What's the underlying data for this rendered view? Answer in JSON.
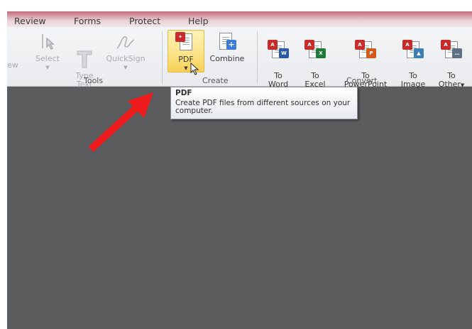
{
  "menu_tabs": [
    "Review",
    "Forms",
    "Protect",
    "Help"
  ],
  "ribbon": {
    "view_partial": "ew",
    "tools": {
      "select_label": "Select",
      "type_text_label": "Type\nText",
      "quicksign_label": "QuickSign",
      "group_label": "Tools"
    },
    "create": {
      "pdf_label": "PDF",
      "combine_label": "Combine",
      "group_label": "Create"
    },
    "convert": {
      "to_word_label": "To\nWord",
      "to_excel_label": "To\nExcel",
      "to_powerpoint_label": "To\nPowerPoint",
      "to_image_label": "To\nImage",
      "to_other_label": "To\nOther",
      "group_label": "Convert"
    }
  },
  "tooltip": {
    "title": "PDF",
    "description": "Create PDF files from different sources on your computer."
  },
  "colors": {
    "workspace": "#5b5c5e",
    "highlight": "#fde38a",
    "arrow": "#ee1c1c"
  }
}
